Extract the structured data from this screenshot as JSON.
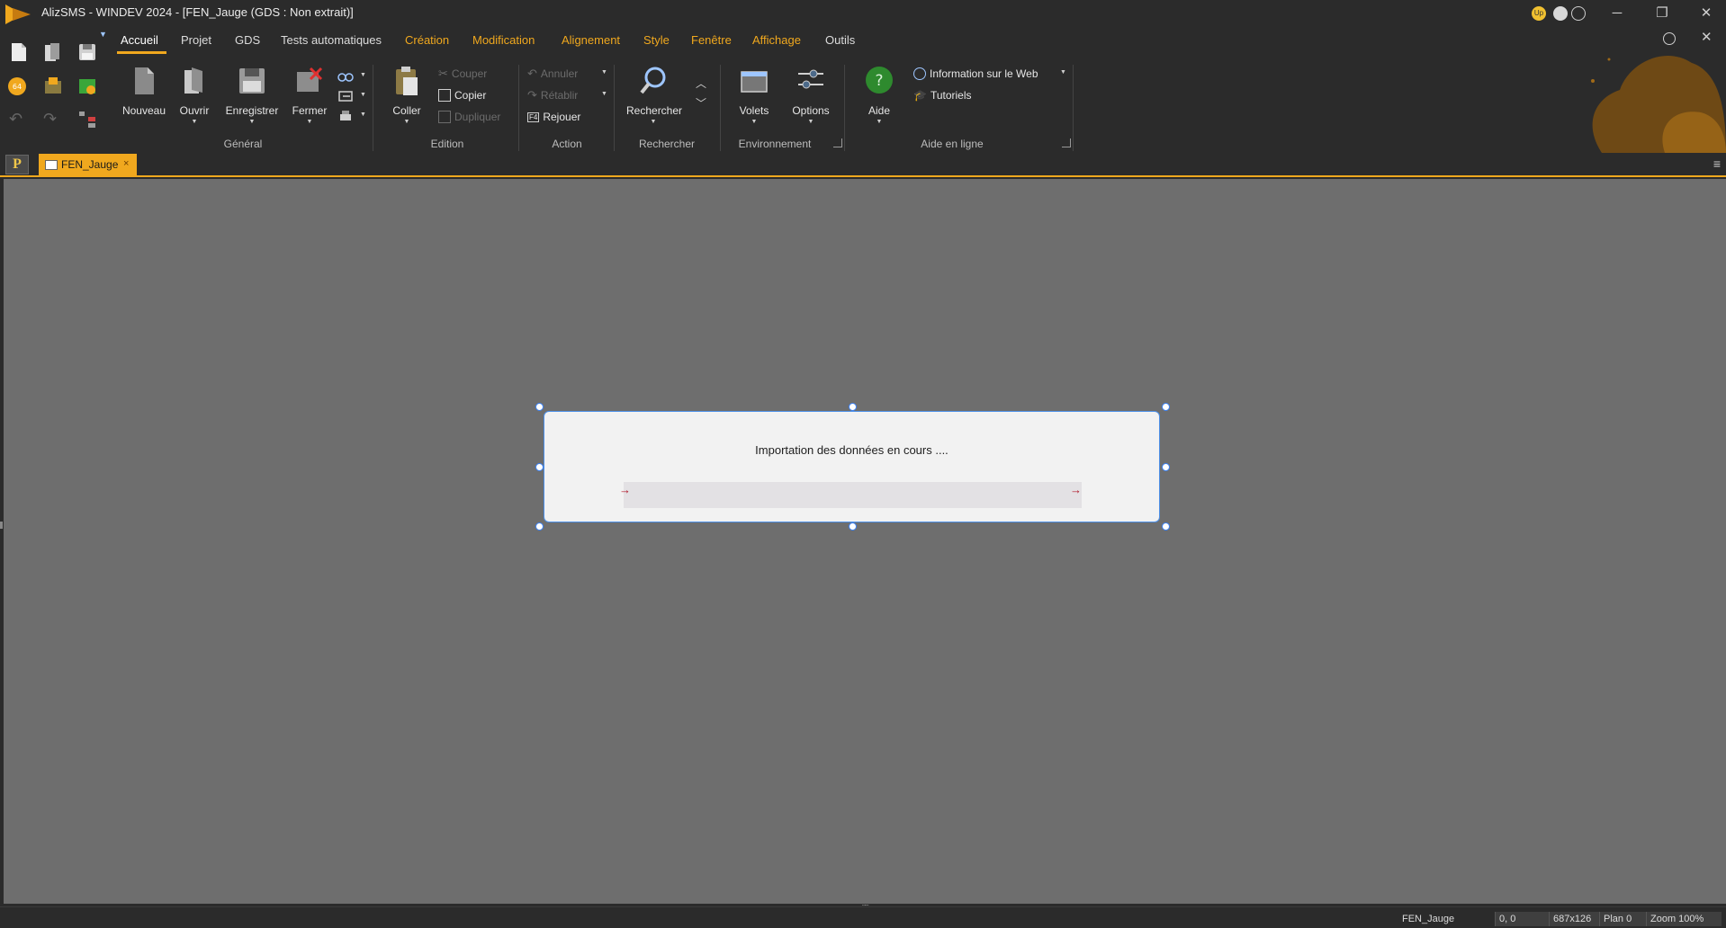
{
  "title_bar": {
    "title": "AlizSMS - WINDEV 2024 - [FEN_Jauge (GDS : Non extrait)]",
    "badge_label": "Up",
    "minimize": "─",
    "restore": "❐",
    "close": "✕"
  },
  "ribbon": {
    "tabs": [
      "Accueil",
      "Projet",
      "GDS",
      "Tests automatiques",
      "Création",
      "Modification",
      "Alignement",
      "Style",
      "Fenêtre",
      "Affichage",
      "Outils"
    ],
    "active_tab": "Accueil",
    "general": {
      "label": "Général",
      "nouveau": "Nouveau",
      "ouvrir": "Ouvrir",
      "enregistrer": "Enregistrer",
      "fermer": "Fermer"
    },
    "edition": {
      "label": "Edition",
      "coller": "Coller",
      "couper": "Couper",
      "copier": "Copier",
      "dupliquer": "Dupliquer"
    },
    "action": {
      "label": "Action",
      "annuler": "Annuler",
      "retablir": "Rétablir",
      "rejouer": "Rejouer",
      "rejouer_key": "F4"
    },
    "rechercher": {
      "label": "Rechercher",
      "rechercher": "Rechercher"
    },
    "environnement": {
      "label": "Environnement",
      "volets": "Volets",
      "options": "Options"
    },
    "aide": {
      "label": "Aide en ligne",
      "aide": "Aide",
      "web": "Information sur le Web",
      "tutoriels": "Tutoriels"
    }
  },
  "quick_access": {
    "badge_64": "64"
  },
  "doc_tabs": {
    "project_letter": "P",
    "active_doc": "FEN_Jauge",
    "close": "×",
    "menu": "≡"
  },
  "design_window": {
    "label_text": "Importation des données en cours ....",
    "gauge_progress": 0,
    "arrow_glyph": "→"
  },
  "status_bar": {
    "element": "FEN_Jauge",
    "position": "0, 0",
    "size": "687x126",
    "plan": "Plan 0",
    "zoom": "Zoom 100%"
  },
  "colors": {
    "accent": "#f0a81e",
    "canvas": "#6e6e6e",
    "window_bg": "#f2f2f2",
    "selection": "#3b82f6",
    "gauge_arrow": "#b0182a"
  }
}
